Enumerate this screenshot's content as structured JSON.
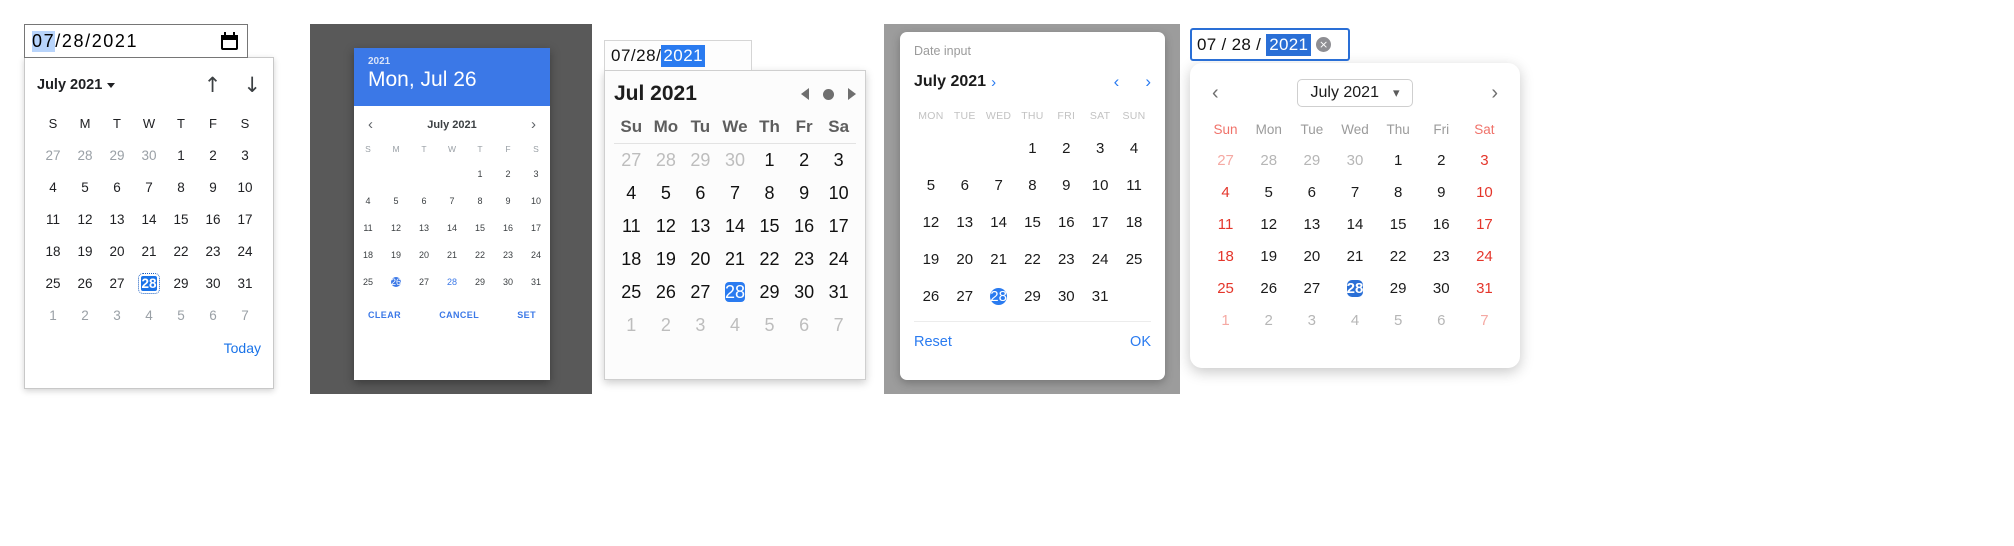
{
  "picker1": {
    "name": "chrome-date-picker",
    "input": {
      "month": "07",
      "sep1": "/",
      "day": "28",
      "sep2": "/",
      "year": "2021",
      "icon": "calendar-icon"
    },
    "header": {
      "month_label": "July 2021",
      "caret": "chevron-down-icon",
      "prev_icon": "↑",
      "next_icon": "↓"
    },
    "weekdays": [
      "S",
      "M",
      "T",
      "W",
      "T",
      "F",
      "S"
    ],
    "weeks": [
      [
        {
          "d": "27",
          "m": true
        },
        {
          "d": "28",
          "m": true
        },
        {
          "d": "29",
          "m": true
        },
        {
          "d": "30",
          "m": true
        },
        {
          "d": "1"
        },
        {
          "d": "2"
        },
        {
          "d": "3"
        }
      ],
      [
        {
          "d": "4"
        },
        {
          "d": "5"
        },
        {
          "d": "6"
        },
        {
          "d": "7"
        },
        {
          "d": "8"
        },
        {
          "d": "9"
        },
        {
          "d": "10"
        }
      ],
      [
        {
          "d": "11"
        },
        {
          "d": "12"
        },
        {
          "d": "13"
        },
        {
          "d": "14"
        },
        {
          "d": "15"
        },
        {
          "d": "16"
        },
        {
          "d": "17"
        }
      ],
      [
        {
          "d": "18"
        },
        {
          "d": "19"
        },
        {
          "d": "20"
        },
        {
          "d": "21"
        },
        {
          "d": "22"
        },
        {
          "d": "23"
        },
        {
          "d": "24"
        }
      ],
      [
        {
          "d": "25"
        },
        {
          "d": "26"
        },
        {
          "d": "27"
        },
        {
          "d": "28",
          "s": true
        },
        {
          "d": "29"
        },
        {
          "d": "30"
        },
        {
          "d": "31"
        }
      ],
      [
        {
          "d": "1",
          "m": true
        },
        {
          "d": "2",
          "m": true
        },
        {
          "d": "3",
          "m": true
        },
        {
          "d": "4",
          "m": true
        },
        {
          "d": "5",
          "m": true
        },
        {
          "d": "6",
          "m": true
        },
        {
          "d": "7",
          "m": true
        }
      ]
    ],
    "today_label": "Today",
    "accent": "#1a73e8"
  },
  "picker2": {
    "name": "material-date-picker",
    "header": {
      "year": "2021",
      "date": "Mon, Jul 26"
    },
    "nav": {
      "prev": "‹",
      "month_label": "July 2021",
      "next": "›"
    },
    "weekdays": [
      "S",
      "M",
      "T",
      "W",
      "T",
      "F",
      "S"
    ],
    "weeks": [
      [
        {
          "d": ""
        },
        {
          "d": ""
        },
        {
          "d": ""
        },
        {
          "d": ""
        },
        {
          "d": "1"
        },
        {
          "d": "2"
        },
        {
          "d": "3"
        }
      ],
      [
        {
          "d": "4"
        },
        {
          "d": "5"
        },
        {
          "d": "6"
        },
        {
          "d": "7"
        },
        {
          "d": "8"
        },
        {
          "d": "9"
        },
        {
          "d": "10"
        }
      ],
      [
        {
          "d": "11"
        },
        {
          "d": "12"
        },
        {
          "d": "13"
        },
        {
          "d": "14"
        },
        {
          "d": "15"
        },
        {
          "d": "16"
        },
        {
          "d": "17"
        }
      ],
      [
        {
          "d": "18"
        },
        {
          "d": "19"
        },
        {
          "d": "20"
        },
        {
          "d": "21"
        },
        {
          "d": "22"
        },
        {
          "d": "23"
        },
        {
          "d": "24"
        }
      ],
      [
        {
          "d": "25"
        },
        {
          "d": "26",
          "s": true
        },
        {
          "d": "27"
        },
        {
          "d": "28",
          "t": true
        },
        {
          "d": "29"
        },
        {
          "d": "30"
        },
        {
          "d": "31"
        }
      ]
    ],
    "buttons": {
      "clear": "CLEAR",
      "cancel": "CANCEL",
      "set": "SET"
    },
    "accent": "#3b78e7"
  },
  "picker3": {
    "name": "safari-date-picker",
    "input": {
      "month": "07",
      "sep1": "/",
      "day": "28",
      "sep2": "/",
      "year": "2021"
    },
    "header": {
      "month_label": "Jul 2021",
      "prev": "prev-triangle-icon",
      "reset": "dot-icon",
      "next": "next-triangle-icon"
    },
    "weekdays": [
      "Su",
      "Mo",
      "Tu",
      "We",
      "Th",
      "Fr",
      "Sa"
    ],
    "weeks": [
      [
        {
          "d": "27",
          "m": true
        },
        {
          "d": "28",
          "m": true
        },
        {
          "d": "29",
          "m": true
        },
        {
          "d": "30",
          "m": true
        },
        {
          "d": "1"
        },
        {
          "d": "2"
        },
        {
          "d": "3"
        }
      ],
      [
        {
          "d": "4"
        },
        {
          "d": "5"
        },
        {
          "d": "6"
        },
        {
          "d": "7"
        },
        {
          "d": "8"
        },
        {
          "d": "9"
        },
        {
          "d": "10"
        }
      ],
      [
        {
          "d": "11"
        },
        {
          "d": "12"
        },
        {
          "d": "13"
        },
        {
          "d": "14"
        },
        {
          "d": "15"
        },
        {
          "d": "16"
        },
        {
          "d": "17"
        }
      ],
      [
        {
          "d": "18"
        },
        {
          "d": "19"
        },
        {
          "d": "20"
        },
        {
          "d": "21"
        },
        {
          "d": "22"
        },
        {
          "d": "23"
        },
        {
          "d": "24"
        }
      ],
      [
        {
          "d": "25"
        },
        {
          "d": "26"
        },
        {
          "d": "27"
        },
        {
          "d": "28",
          "s": true
        },
        {
          "d": "29"
        },
        {
          "d": "30"
        },
        {
          "d": "31"
        }
      ],
      [
        {
          "d": "1",
          "m": true
        },
        {
          "d": "2",
          "m": true
        },
        {
          "d": "3",
          "m": true
        },
        {
          "d": "4",
          "m": true
        },
        {
          "d": "5",
          "m": true
        },
        {
          "d": "6",
          "m": true
        },
        {
          "d": "7",
          "m": true
        }
      ]
    ],
    "accent": "#2a7bf0"
  },
  "picker4": {
    "name": "firefox-date-picker",
    "label": "Date input",
    "header": {
      "month_label": "July 2021",
      "month_chevron": "›",
      "prev": "‹",
      "next": "›"
    },
    "weekdays": [
      "MON",
      "TUE",
      "WED",
      "THU",
      "FRI",
      "SAT",
      "SUN"
    ],
    "weeks": [
      [
        {
          "d": ""
        },
        {
          "d": ""
        },
        {
          "d": ""
        },
        {
          "d": "1"
        },
        {
          "d": "2"
        },
        {
          "d": "3"
        },
        {
          "d": "4"
        }
      ],
      [
        {
          "d": "5"
        },
        {
          "d": "6"
        },
        {
          "d": "7"
        },
        {
          "d": "8"
        },
        {
          "d": "9"
        },
        {
          "d": "10"
        },
        {
          "d": "11"
        }
      ],
      [
        {
          "d": "12"
        },
        {
          "d": "13"
        },
        {
          "d": "14"
        },
        {
          "d": "15"
        },
        {
          "d": "16"
        },
        {
          "d": "17"
        },
        {
          "d": "18"
        }
      ],
      [
        {
          "d": "19"
        },
        {
          "d": "20"
        },
        {
          "d": "21"
        },
        {
          "d": "22"
        },
        {
          "d": "23"
        },
        {
          "d": "24"
        },
        {
          "d": "25"
        }
      ],
      [
        {
          "d": "26"
        },
        {
          "d": "27"
        },
        {
          "d": "28",
          "s": true
        },
        {
          "d": "29"
        },
        {
          "d": "30"
        },
        {
          "d": "31"
        },
        {
          "d": ""
        }
      ]
    ],
    "buttons": {
      "reset": "Reset",
      "ok": "OK"
    },
    "accent": "#2a7bf0"
  },
  "picker5": {
    "name": "ios-date-picker",
    "input": {
      "month": "07",
      "sep1": "/",
      "day": "28",
      "sep2": "/",
      "year": "2021",
      "clear_icon": "×"
    },
    "header": {
      "prev": "‹",
      "month_label": "July 2021",
      "dropdown_icon": "⌄",
      "next": "›"
    },
    "weekdays": [
      "Sun",
      "Mon",
      "Tue",
      "Wed",
      "Thu",
      "Fri",
      "Sat"
    ],
    "weeks": [
      [
        {
          "d": "27",
          "m": true,
          "w": true
        },
        {
          "d": "28",
          "m": true
        },
        {
          "d": "29",
          "m": true
        },
        {
          "d": "30",
          "m": true
        },
        {
          "d": "1"
        },
        {
          "d": "2"
        },
        {
          "d": "3",
          "w": true
        }
      ],
      [
        {
          "d": "4",
          "w": true
        },
        {
          "d": "5"
        },
        {
          "d": "6"
        },
        {
          "d": "7"
        },
        {
          "d": "8"
        },
        {
          "d": "9"
        },
        {
          "d": "10",
          "w": true
        }
      ],
      [
        {
          "d": "11",
          "w": true
        },
        {
          "d": "12"
        },
        {
          "d": "13"
        },
        {
          "d": "14"
        },
        {
          "d": "15"
        },
        {
          "d": "16"
        },
        {
          "d": "17",
          "w": true
        }
      ],
      [
        {
          "d": "18",
          "w": true
        },
        {
          "d": "19"
        },
        {
          "d": "20"
        },
        {
          "d": "21"
        },
        {
          "d": "22"
        },
        {
          "d": "23"
        },
        {
          "d": "24",
          "w": true
        }
      ],
      [
        {
          "d": "25",
          "w": true
        },
        {
          "d": "26"
        },
        {
          "d": "27"
        },
        {
          "d": "28",
          "s": true
        },
        {
          "d": "29"
        },
        {
          "d": "30"
        },
        {
          "d": "31",
          "w": true
        }
      ],
      [
        {
          "d": "1",
          "m": true,
          "w": true
        },
        {
          "d": "2",
          "m": true
        },
        {
          "d": "3",
          "m": true
        },
        {
          "d": "4",
          "m": true
        },
        {
          "d": "5",
          "m": true
        },
        {
          "d": "6",
          "m": true
        },
        {
          "d": "7",
          "m": true,
          "w": true
        }
      ]
    ],
    "accent": "#2a6fd6",
    "weekend_color": "#e4362b"
  }
}
